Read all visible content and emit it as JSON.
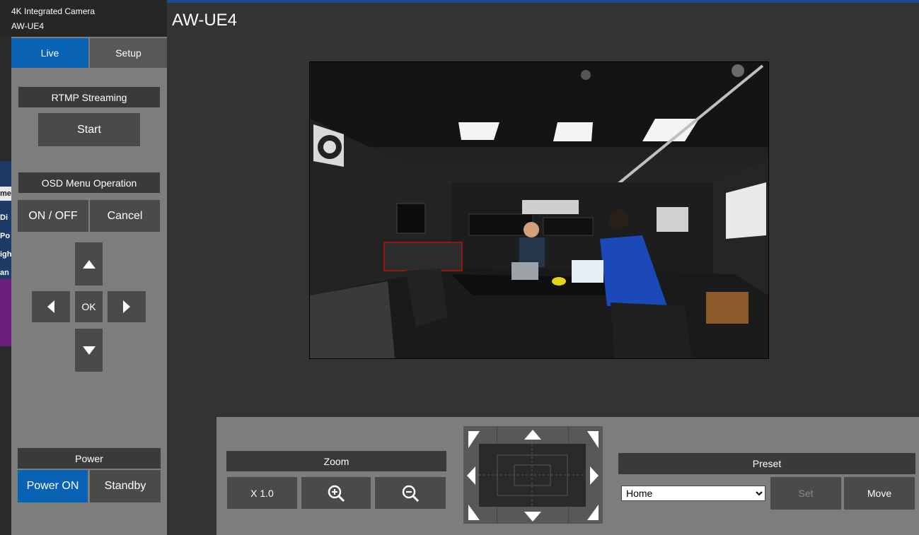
{
  "camera": {
    "line1": "4K Integrated Camera",
    "line2": "AW-UE4"
  },
  "page_title": "AW-UE4",
  "tabs": {
    "live": "Live",
    "setup": "Setup"
  },
  "rtmp": {
    "header": "RTMP Streaming",
    "start": "Start"
  },
  "osd": {
    "header": "OSD Menu Operation",
    "onoff": "ON / OFF",
    "cancel": "Cancel",
    "ok": "OK"
  },
  "power": {
    "header": "Power",
    "on": "Power ON",
    "standby": "Standby"
  },
  "zoom": {
    "header": "Zoom",
    "level": "X 1.0"
  },
  "preset": {
    "header": "Preset",
    "selected": "Home",
    "set": "Set",
    "move": "Move"
  },
  "background_partial": {
    "items": [
      "me",
      "Di",
      "Po",
      "igh",
      "an"
    ]
  },
  "colors": {
    "accent": "#0a62b5",
    "panel": "#7d7d7d",
    "button": "#4a4a4a",
    "main_bg": "#333333"
  }
}
